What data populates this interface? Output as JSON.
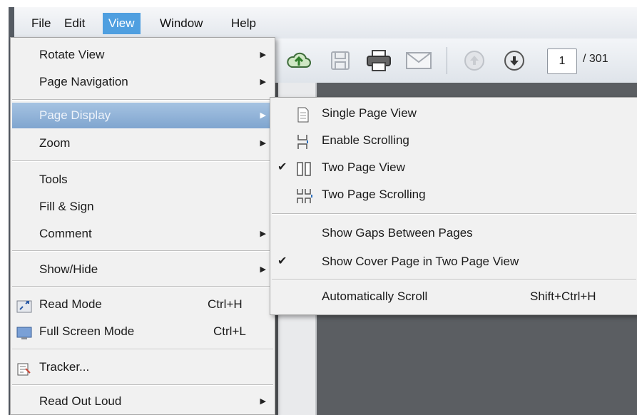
{
  "menubar": {
    "items": [
      {
        "label": "File"
      },
      {
        "label": "Edit"
      },
      {
        "label": "View"
      },
      {
        "label": "Window"
      },
      {
        "label": "Help"
      }
    ],
    "active": "View"
  },
  "toolbar": {
    "icons": [
      "cloud-upload-icon",
      "save-icon",
      "print-icon",
      "email-icon",
      "page-up-icon",
      "page-down-icon"
    ],
    "page_current": "1",
    "page_total": "/ 301"
  },
  "view_menu": {
    "items": [
      {
        "label": "Rotate View",
        "submenu": true
      },
      {
        "label": "Page Navigation",
        "submenu": true
      },
      {
        "label": "Page Display",
        "submenu": true,
        "highlighted": true
      },
      {
        "label": "Zoom",
        "submenu": true
      },
      {
        "label": "Tools"
      },
      {
        "label": "Fill & Sign"
      },
      {
        "label": "Comment",
        "submenu": true
      },
      {
        "label": "Show/Hide",
        "submenu": true
      },
      {
        "label": "Read Mode",
        "shortcut": "Ctrl+H",
        "icon": "read-mode-icon"
      },
      {
        "label": "Full Screen Mode",
        "shortcut": "Ctrl+L",
        "icon": "full-screen-icon"
      },
      {
        "label": "Tracker...",
        "icon": "tracker-icon"
      },
      {
        "label": "Read Out Loud",
        "submenu": true
      }
    ]
  },
  "page_display_menu": {
    "items": [
      {
        "label": "Single Page View",
        "icon": "single-page-icon"
      },
      {
        "label": "Enable Scrolling",
        "icon": "scrolling-icon"
      },
      {
        "label": "Two Page View",
        "icon": "two-page-icon",
        "checked": true
      },
      {
        "label": "Two Page Scrolling",
        "icon": "two-page-scrolling-icon"
      },
      {
        "label": "Show Gaps Between Pages"
      },
      {
        "label": "Show Cover Page in Two Page View",
        "checked": true
      },
      {
        "label": "Automatically Scroll",
        "shortcut": "Shift+Ctrl+H"
      }
    ],
    "check_glyph": "✔"
  },
  "colors": {
    "menu_highlight": "#8fb1d8",
    "menubar_active": "#4f9fe0",
    "document_background": "#5b5e62"
  }
}
